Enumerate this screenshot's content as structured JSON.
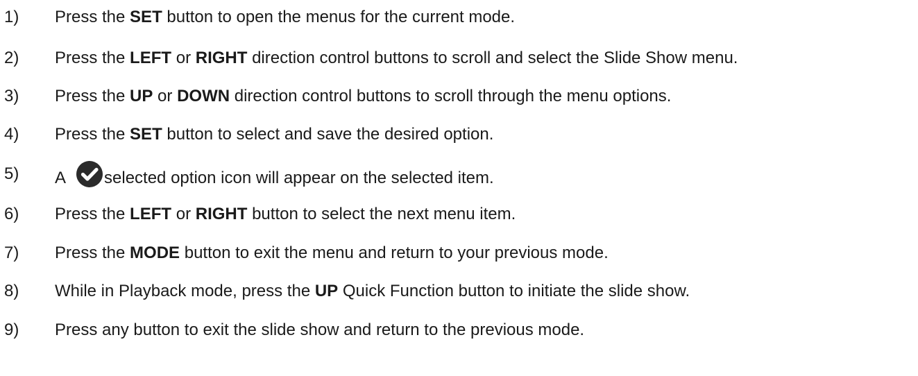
{
  "steps": [
    {
      "number": "1)",
      "parts": [
        {
          "text": "Press the ",
          "bold": false
        },
        {
          "text": "SET",
          "bold": true
        },
        {
          "text": " button to open the menus for the current mode.",
          "bold": false
        }
      ]
    },
    {
      "number": "2)",
      "parts": [
        {
          "text": "Press the ",
          "bold": false
        },
        {
          "text": "LEFT",
          "bold": true
        },
        {
          "text": " or ",
          "bold": false
        },
        {
          "text": "RIGHT",
          "bold": true
        },
        {
          "text": " direction control buttons to scroll and select the Slide Show menu.",
          "bold": false
        }
      ]
    },
    {
      "number": "3)",
      "parts": [
        {
          "text": "Press the ",
          "bold": false
        },
        {
          "text": "UP",
          "bold": true
        },
        {
          "text": " or ",
          "bold": false
        },
        {
          "text": "DOWN",
          "bold": true
        },
        {
          "text": " direction control buttons to scroll through the menu options.",
          "bold": false
        }
      ]
    },
    {
      "number": "4)",
      "parts": [
        {
          "text": "Press the ",
          "bold": false
        },
        {
          "text": "SET",
          "bold": true
        },
        {
          "text": " button to select and save the desired option.",
          "bold": false
        }
      ]
    },
    {
      "number": "5)",
      "parts": [
        {
          "text": "A",
          "bold": false
        },
        {
          "icon": "check-circle-icon"
        },
        {
          "text": "selected option icon will appear on the selected item.",
          "bold": false
        }
      ]
    },
    {
      "number": "6)",
      "parts": [
        {
          "text": "Press the ",
          "bold": false
        },
        {
          "text": "LEFT",
          "bold": true
        },
        {
          "text": " or ",
          "bold": false
        },
        {
          "text": "RIGHT",
          "bold": true
        },
        {
          "text": " button to select the next menu item.",
          "bold": false
        }
      ]
    },
    {
      "number": "7)",
      "parts": [
        {
          "text": "Press the ",
          "bold": false
        },
        {
          "text": "MODE",
          "bold": true
        },
        {
          "text": " button to exit the menu and return to your previous mode.",
          "bold": false
        }
      ]
    },
    {
      "number": "8)",
      "parts": [
        {
          "text": "While in Playback mode, press the ",
          "bold": false
        },
        {
          "text": "UP",
          "bold": true
        },
        {
          "text": " Quick Function button to initiate the slide show.",
          "bold": false
        }
      ]
    },
    {
      "number": "9)",
      "parts": [
        {
          "text": "Press any button to exit the slide show and return to the previous mode.",
          "bold": false
        }
      ]
    }
  ],
  "colors": {
    "text": "#1a1a1a",
    "icon_fill": "#2b2b2b",
    "icon_check": "#ffffff"
  }
}
